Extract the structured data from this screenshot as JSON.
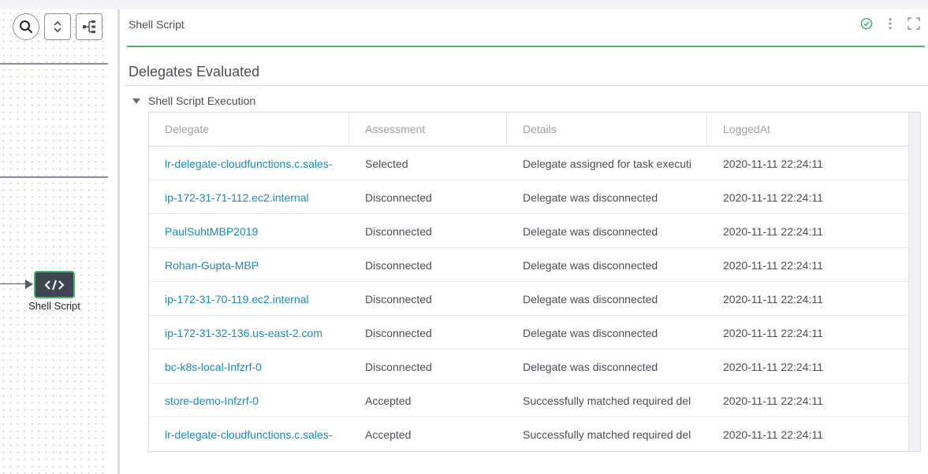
{
  "colors": {
    "accent_green": "#48b66a",
    "link_blue": "#1a89bf",
    "node_bg": "#3f4553"
  },
  "canvas": {
    "toolbar": [
      {
        "name": "search-button",
        "icon": "search-icon"
      },
      {
        "name": "expand-collapse-button",
        "icon": "chevron-up-down-icon"
      },
      {
        "name": "layout-button",
        "icon": "tree-layout-icon"
      }
    ],
    "node": {
      "label": "Shell Script",
      "icon": "code-icon"
    }
  },
  "panel": {
    "title": "Shell Script",
    "status_icon": "success-check-icon",
    "menu_icon": "more-vertical-icon",
    "expand_icon": "fullscreen-icon",
    "section_title": "Delegates Evaluated",
    "group_label": "Shell Script Execution",
    "table": {
      "headers": [
        "Delegate",
        "Assessment",
        "Details",
        "LoggedAt"
      ],
      "rows": [
        [
          "lr-delegate-cloudfunctions.c.sales-",
          "Selected",
          "Delegate assigned for task executi",
          "2020-11-11 22:24:11"
        ],
        [
          "ip-172-31-71-112.ec2.internal",
          "Disconnected",
          "Delegate was disconnected",
          "2020-11-11 22:24:11"
        ],
        [
          "PaulSuhtMBP2019",
          "Disconnected",
          "Delegate was disconnected",
          "2020-11-11 22:24:11"
        ],
        [
          "Rohan-Gupta-MBP",
          "Disconnected",
          "Delegate was disconnected",
          "2020-11-11 22:24:11"
        ],
        [
          "ip-172-31-70-119.ec2.internal",
          "Disconnected",
          "Delegate was disconnected",
          "2020-11-11 22:24:11"
        ],
        [
          "ip-172-31-32-136.us-east-2.com",
          "Disconnected",
          "Delegate was disconnected",
          "2020-11-11 22:24:11"
        ],
        [
          "bc-k8s-local-Infzrf-0",
          "Disconnected",
          "Delegate was disconnected",
          "2020-11-11 22:24:11"
        ],
        [
          "store-demo-Infzrf-0",
          "Accepted",
          "Successfully matched required del",
          "2020-11-11 22:24:11"
        ],
        [
          "lr-delegate-cloudfunctions.c.sales-",
          "Accepted",
          "Successfully matched required del",
          "2020-11-11 22:24:11"
        ]
      ]
    }
  }
}
